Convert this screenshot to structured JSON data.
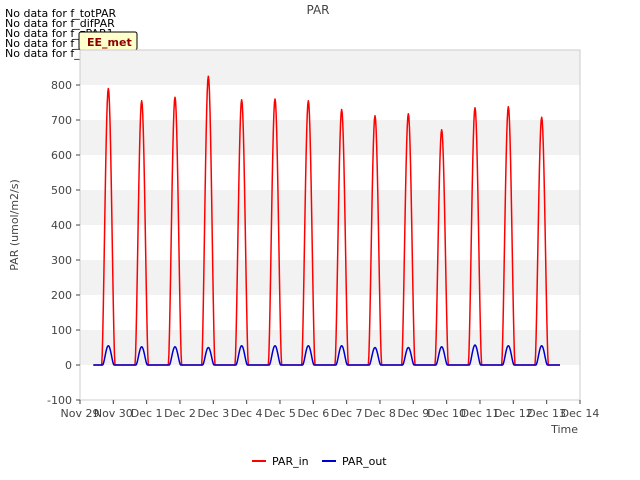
{
  "chart_data": {
    "type": "line",
    "title": "PAR",
    "xlabel": "Time",
    "ylabel": "PAR (umol/m2/s)",
    "ylim": [
      -100,
      900
    ],
    "yticks": [
      -100,
      0,
      100,
      200,
      300,
      400,
      500,
      600,
      700,
      800
    ],
    "xlim": [
      0,
      15
    ],
    "xtick_labels": [
      "Nov 29",
      "Nov 30",
      "Dec 1",
      "Dec 2",
      "Dec 3",
      "Dec 4",
      "Dec 5",
      "Dec 6",
      "Dec 7",
      "Dec 8",
      "Dec 9",
      "Dec 10",
      "Dec 11",
      "Dec 12",
      "Dec 13",
      "Dec 14"
    ],
    "grid": "horizontal bands",
    "legend_position": "bottom-center",
    "series": [
      {
        "name": "PAR_in",
        "color": "#ff0000",
        "daily_peaks": [
          {
            "x": 0.85,
            "y": 790
          },
          {
            "x": 1.85,
            "y": 755
          },
          {
            "x": 2.85,
            "y": 765
          },
          {
            "x": 3.85,
            "y": 825
          },
          {
            "x": 4.85,
            "y": 758
          },
          {
            "x": 5.85,
            "y": 760
          },
          {
            "x": 6.85,
            "y": 755
          },
          {
            "x": 7.85,
            "y": 730
          },
          {
            "x": 8.85,
            "y": 712
          },
          {
            "x": 9.85,
            "y": 718
          },
          {
            "x": 10.85,
            "y": 672
          },
          {
            "x": 11.85,
            "y": 735
          },
          {
            "x": 12.85,
            "y": 738
          },
          {
            "x": 13.85,
            "y": 708
          }
        ]
      },
      {
        "name": "PAR_out",
        "color": "#0000cc",
        "daily_peaks": [
          {
            "x": 0.85,
            "y": 55
          },
          {
            "x": 1.85,
            "y": 52
          },
          {
            "x": 2.85,
            "y": 52
          },
          {
            "x": 3.85,
            "y": 50
          },
          {
            "x": 4.85,
            "y": 55
          },
          {
            "x": 5.85,
            "y": 55
          },
          {
            "x": 6.85,
            "y": 55
          },
          {
            "x": 7.85,
            "y": 55
          },
          {
            "x": 8.85,
            "y": 50
          },
          {
            "x": 9.85,
            "y": 50
          },
          {
            "x": 10.85,
            "y": 52
          },
          {
            "x": 11.85,
            "y": 57
          },
          {
            "x": 12.85,
            "y": 55
          },
          {
            "x": 13.85,
            "y": 55
          }
        ]
      }
    ],
    "series_xrange": [
      0.4,
      14.4
    ]
  },
  "messages": [
    "No data for f_totPAR",
    "No data for f_difPAR",
    "No data for f_zPAR1",
    "No data for f_zPAR2",
    "No data for f_zPAR3"
  ],
  "badge": "EE_met",
  "colors": {
    "band": "#f2f2f2",
    "badge_bg": "#ffffcc",
    "badge_border": "#000000"
  }
}
